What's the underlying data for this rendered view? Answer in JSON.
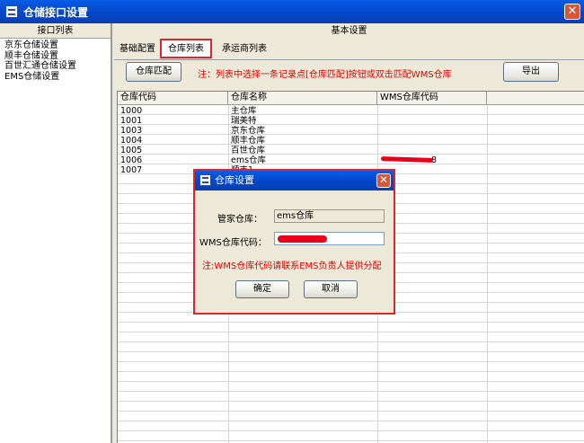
{
  "window": {
    "title": "仓储接口设置",
    "close": "✕"
  },
  "left_panel": {
    "header": "接口列表",
    "items": [
      "京东仓储设置",
      "顺丰仓储设置",
      "百世汇通仓储设置",
      "EMS仓储设置"
    ]
  },
  "right_panel": {
    "header": "基本设置",
    "tabs": [
      {
        "label": "基础配置",
        "active": false
      },
      {
        "label": "仓库列表",
        "active": true
      },
      {
        "label": "承运商列表",
        "active": false
      }
    ],
    "match_button": "仓库匹配",
    "note": "注：列表中选择一条记录点[仓库匹配]按钮或双击匹配WMS仓库",
    "export_button": "导出",
    "table": {
      "columns": [
        "仓库代码",
        "仓库名称",
        "WMS仓库代码"
      ],
      "rows": [
        [
          "1000",
          "主仓库",
          ""
        ],
        [
          "1001",
          "瑞美特",
          ""
        ],
        [
          "1003",
          "京东仓库",
          ""
        ],
        [
          "1004",
          "顺丰仓库",
          ""
        ],
        [
          "1005",
          "百世仓库",
          ""
        ],
        [
          "1006",
          "ems仓库",
          "8"
        ],
        [
          "1007",
          "顺丰1",
          ""
        ]
      ]
    }
  },
  "dialog": {
    "title": "仓库设置",
    "close": "✕",
    "field1_label": "管家仓库：",
    "field1_value": "ems仓库",
    "field2_label": "WMS仓库代码：",
    "field2_value": "",
    "note": "注:WMS仓库代码请联系EMS负责人提供分配",
    "ok_button": "确定",
    "cancel_button": "取消"
  },
  "colors": {
    "accent_red": "#e0242a",
    "title_blue": "#0347c9",
    "note_red": "#e00000"
  }
}
